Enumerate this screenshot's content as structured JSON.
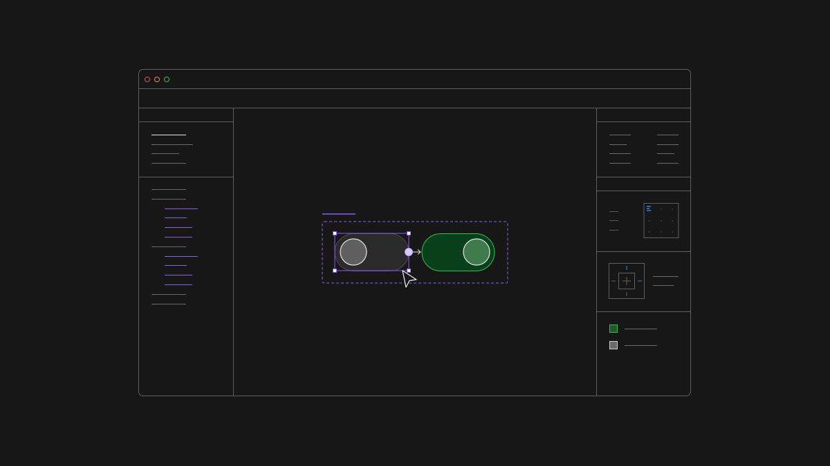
{
  "window": {
    "traffic_lights": [
      {
        "name": "close-button",
        "color": "#e5534b"
      },
      {
        "name": "minimize-button",
        "color": "#e8875a"
      },
      {
        "name": "maximize-button",
        "color": "#3fb950"
      }
    ]
  },
  "canvas": {
    "selection_color": "#8c5cf0",
    "toggle_off": {
      "state": "off",
      "track_color": "#2a2a2a",
      "knob_color": "#5f5f5f"
    },
    "toggle_on": {
      "state": "on",
      "track_color": "#08401c",
      "border_color": "#3fb950",
      "knob_color": "#3e7a4c"
    }
  },
  "right_panel": {
    "swatches": [
      {
        "name": "green-swatch",
        "color": "#1d5a2d",
        "border": "#3fb950"
      },
      {
        "name": "grey-swatch",
        "color": "#6a6a6a",
        "border": "#cfcfcf"
      }
    ],
    "accent_blue": "#2f81f7"
  }
}
